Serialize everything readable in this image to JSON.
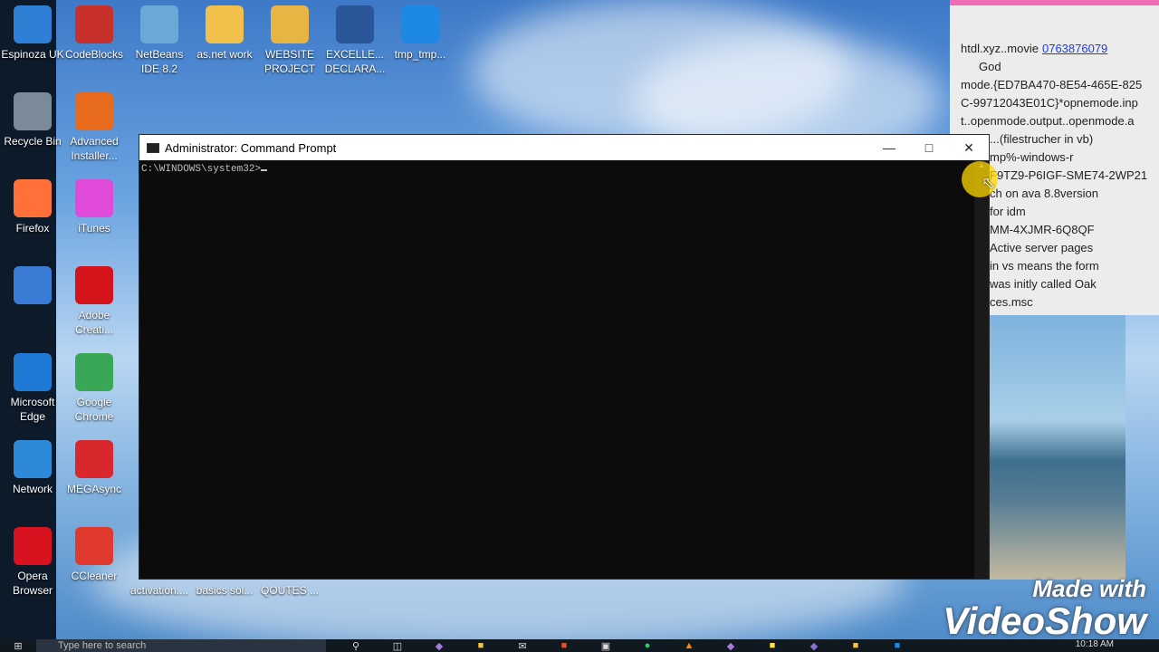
{
  "desktop": {
    "col1": [
      {
        "label": "Espinoza UK",
        "icon": "computer-icon",
        "color": "#2f7fd6"
      },
      {
        "label": "Recycle Bin",
        "icon": "recycle-bin-icon",
        "color": "#7a8a99"
      },
      {
        "label": "Firefox",
        "icon": "firefox-icon",
        "color": "#ff7139"
      },
      {
        "label": "",
        "icon": "control-panel-icon",
        "color": "#3a7bd5"
      },
      {
        "label": "Microsoft Edge",
        "icon": "edge-icon",
        "color": "#1f7ad6"
      },
      {
        "label": "Network",
        "icon": "network-icon",
        "color": "#2d8ad8"
      },
      {
        "label": "Opera Browser",
        "icon": "opera-icon",
        "color": "#d8121f"
      }
    ],
    "col2": [
      {
        "label": "CodeBlocks",
        "icon": "codeblocks-icon",
        "color": "#c7302b"
      },
      {
        "label": "Advanced Installer...",
        "icon": "advanced-installer-icon",
        "color": "#e86b1d"
      },
      {
        "label": "iTunes",
        "icon": "itunes-icon",
        "color": "#e04ad8"
      },
      {
        "label": "Adobe Creati...",
        "icon": "adobe-cc-icon",
        "color": "#d4131a"
      },
      {
        "label": "Google Chrome",
        "icon": "chrome-icon",
        "color": "#3aa757"
      },
      {
        "label": "MEGAsync",
        "icon": "mega-icon",
        "color": "#d9272e"
      },
      {
        "label": "CCleaner",
        "icon": "ccleaner-icon",
        "color": "#e03a2e"
      }
    ],
    "row_top": [
      {
        "label": "NetBeans IDE 8.2",
        "icon": "netbeans-icon",
        "color": "#6aa8d8"
      },
      {
        "label": "as.net work",
        "icon": "folder-icon",
        "color": "#f2c14b"
      },
      {
        "label": "WEBSITE PROJECT",
        "icon": "folder-icon",
        "color": "#e8b544"
      },
      {
        "label": "EXCELLE... DECLARA...",
        "icon": "word-document-icon",
        "color": "#2b579a"
      },
      {
        "label": "tmp_tmp...",
        "icon": "media-file-icon",
        "color": "#1e88e5"
      }
    ],
    "row_bottom": [
      {
        "label": "activation....",
        "icon": "document-icon",
        "color": "#888888"
      },
      {
        "label": "basics sol...",
        "icon": "document-icon",
        "color": "#888888"
      },
      {
        "label": "QOUTES ...",
        "icon": "document-icon",
        "color": "#888888"
      }
    ]
  },
  "cmd": {
    "title": "Administrator: Command Prompt",
    "prompt": "C:\\WINDOWS\\system32>"
  },
  "notes": {
    "lines": [
      "htdl.xyz..movie",
      "God",
      "mode.{ED7BA470-8E54-465E-825",
      "C-99712043E01C}*opnemode.inp",
      "t..openmode.output..openmode.a",
      "...(filestrucher in vb)",
      "mp%-windows-r",
      "F9TZ9-P6IGF-SME74-2WP21",
      "ch on ava 8.8version",
      "for idm",
      "MM-4XJMR-6Q8QF",
      "Active server pages",
      "in vs means the form",
      "was initly called Oak",
      "ces.msc"
    ],
    "link": "0763876079"
  },
  "taskbar": {
    "search_placeholder": "Type here to search",
    "time": "10:18 AM"
  },
  "watermark": {
    "line1": "Made with",
    "line2": "VideoShow"
  }
}
